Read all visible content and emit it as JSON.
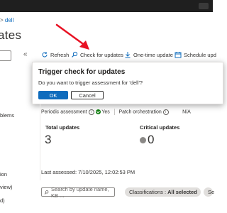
{
  "breadcrumb": {
    "separator": ">",
    "current": "dell"
  },
  "page": {
    "title": "ates"
  },
  "sidebar": {
    "collapse_glyph": "«",
    "items": [
      "blems",
      "ion",
      "view)",
      "d)"
    ]
  },
  "toolbar": {
    "refresh": "Refresh",
    "check_for_updates": "Check for updates",
    "one_time_update": "One-time update",
    "schedule_updates": "Schedule upd"
  },
  "dialog": {
    "title": "Trigger check for updates",
    "message": "Do you want to trigger assessment for 'dell'?",
    "ok_label": "OK",
    "cancel_label": "Cancel"
  },
  "status": {
    "periodic_assessment_label": "Periodic assessment",
    "periodic_assessment_value": "Yes",
    "patch_orchestration_label": "Patch orchestration",
    "patch_orchestration_value": "N/A",
    "info_glyph": "i"
  },
  "cards": {
    "total_updates_label": "Total updates",
    "total_updates_value": "3",
    "critical_updates_label": "Critical updates",
    "critical_updates_value": "0"
  },
  "last_assessed": "Last assessed: 7/10/2025, 12:02:53 PM",
  "filters": {
    "search_placeholder": "Search by update name, KB ...",
    "classifications_label": "Classifications :",
    "classifications_value": "All selected",
    "next_pill": "Se"
  },
  "colors": {
    "accent": "#0f6cbd",
    "arrow": "#e81123",
    "success": "#107c10"
  }
}
